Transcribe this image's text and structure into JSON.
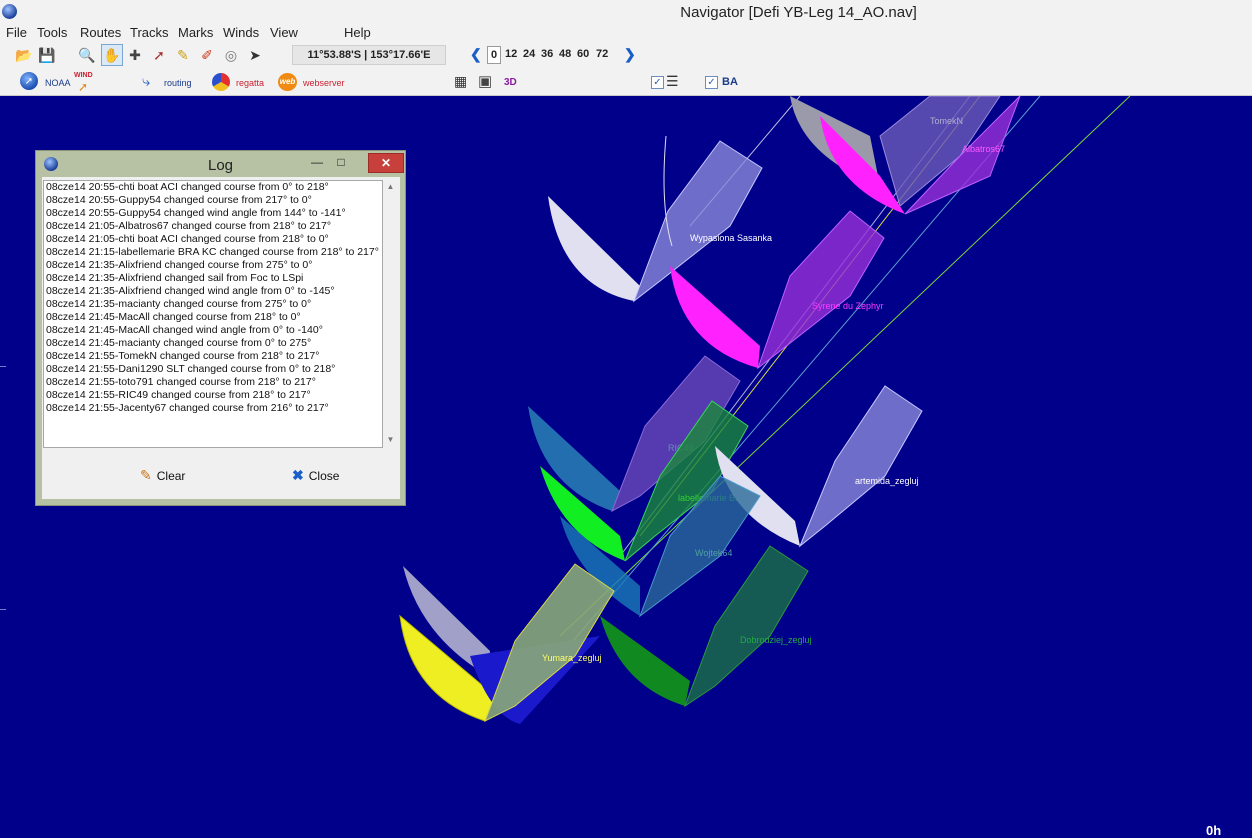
{
  "window": {
    "title": "Navigator [Defi YB-Leg 14_AO.nav]"
  },
  "menu": [
    "File",
    "Tools",
    "Routes",
    "Tracks",
    "Marks",
    "Winds",
    "View",
    "Help"
  ],
  "toolbar": {
    "position": "11°53.88'S | 153°17.66'E",
    "hours": [
      "0",
      "12",
      "24",
      "36",
      "48",
      "60",
      "72"
    ],
    "selected_hour": "0"
  },
  "toolbar2": {
    "noaa": "NOAA",
    "wind": "WIND",
    "routing": "routing",
    "regatta": "regatta",
    "webserver": "webserver",
    "three_d": "3D",
    "ba": "BA"
  },
  "boats": [
    {
      "name": "Wypasiona Sasanka",
      "color": "#ffffff"
    },
    {
      "name": "Syrene du Zephyr",
      "color": "#ff3bff"
    },
    {
      "name": "TomekN",
      "color": "#b0b0d0"
    },
    {
      "name": "Albatros67",
      "color": "#ff5bff"
    },
    {
      "name": "labellemarie BRA KC",
      "color": "#33cc33"
    },
    {
      "name": "artemida_zegluj",
      "color": "#ffffff"
    },
    {
      "name": "Wojtek64",
      "color": "#4fa0a0"
    },
    {
      "name": "Yumara_zegluj",
      "color": "#ffff66"
    },
    {
      "name": "Dobrodziej_zegluj",
      "color": "#22aa44"
    },
    {
      "name": "RIC49",
      "color": "#6f8fb0"
    }
  ],
  "map_corner_label": "0h",
  "log": {
    "title": "Log",
    "entries": [
      "08cze14 20:55-chti boat ACI changed course from 0° to 218°",
      "08cze14 20:55-Guppy54 changed course from 217° to 0°",
      "08cze14 20:55-Guppy54 changed wind angle from 144° to -141°",
      "08cze14 21:05-Albatros67 changed course from 218° to 217°",
      "08cze14 21:05-chti boat ACI changed course from 218° to 0°",
      "08cze14 21:15-labellemarie BRA KC changed course from 218° to 217°",
      "08cze14 21:35-Alixfriend changed course from 275° to 0°",
      "08cze14 21:35-Alixfriend changed sail from Foc to LSpi",
      "08cze14 21:35-Alixfriend changed wind angle from 0° to -145°",
      "08cze14 21:35-macianty changed course from 275° to 0°",
      "08cze14 21:45-MacAll changed course from 218° to 0°",
      "08cze14 21:45-MacAll changed wind angle from 0° to -140°",
      "08cze14 21:45-macianty changed course from 0° to 275°",
      "08cze14 21:55-TomekN changed course from 218° to 217°",
      "08cze14 21:55-Dani1290 SLT changed course from 0° to 218°",
      "08cze14 21:55-toto791 changed course from 218° to 217°",
      "08cze14 21:55-RIC49 changed course from 218° to 217°",
      "08cze14 21:55-Jacenty67 changed course from 216° to 217°"
    ],
    "clear_label": "Clear",
    "close_label": "Close"
  }
}
